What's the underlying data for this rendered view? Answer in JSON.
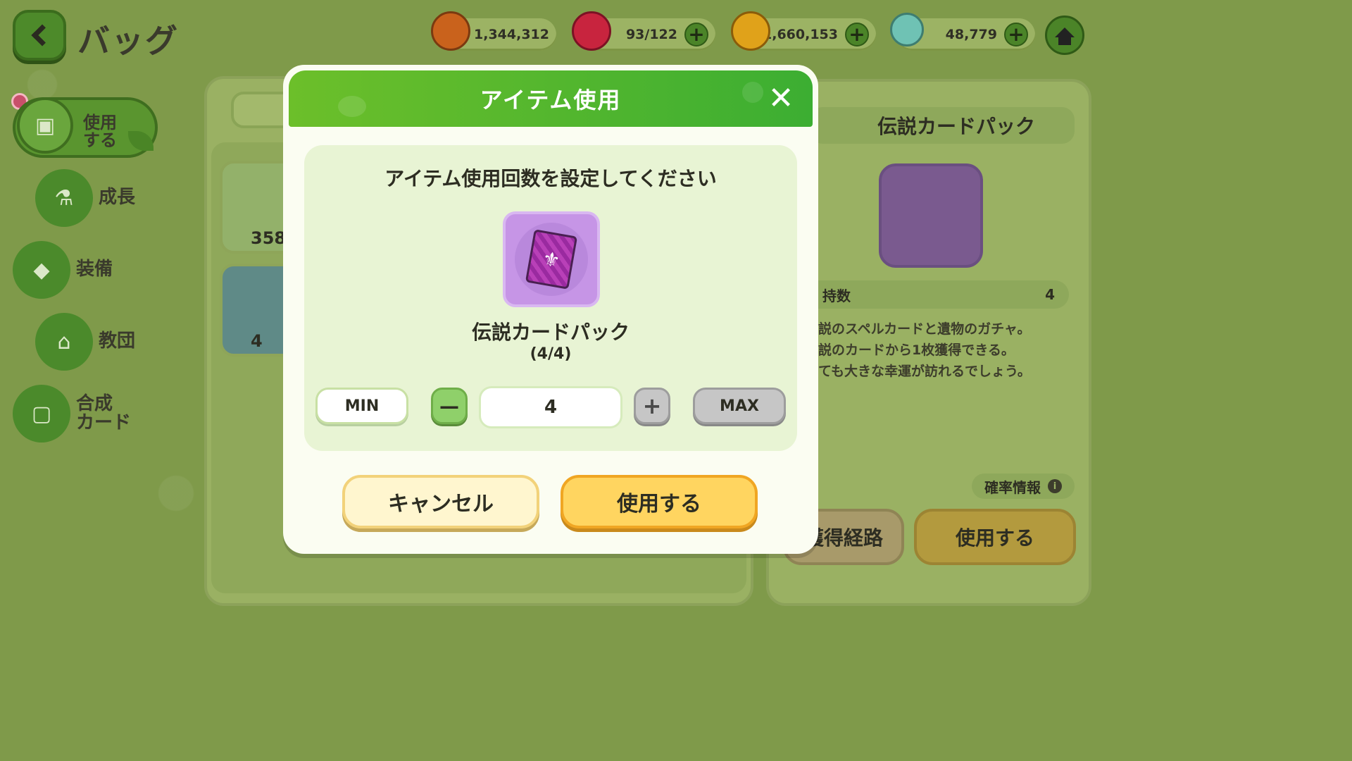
{
  "header": {
    "title": "バッグ",
    "back_icon": "chevron-left-icon",
    "home_icon": "home-icon"
  },
  "currencies": [
    {
      "name": "macaron",
      "icon": "macaron-icon",
      "value": "1,344,312",
      "color": "#c9621c",
      "has_plus": false
    },
    {
      "name": "stamina",
      "icon": "red-candy-icon",
      "value": "93/122",
      "color": "#c8243e",
      "has_plus": true
    },
    {
      "name": "gold",
      "icon": "gold-coin-icon",
      "value": "1,660,153",
      "color": "#e0a21a",
      "has_plus": true
    },
    {
      "name": "crystal",
      "icon": "crystal-leaf-icon",
      "value": "48,779",
      "color": "#6fc2b4",
      "has_plus": true
    }
  ],
  "sidebar": {
    "items": [
      {
        "label_line1": "使用",
        "label_line2": "する",
        "active": true
      },
      {
        "label": "成長"
      },
      {
        "label": "装備"
      },
      {
        "label": "教団"
      },
      {
        "label_line1": "合成",
        "label_line2": "カード"
      }
    ]
  },
  "inventory": {
    "slots": [
      {
        "count": "358"
      },
      {
        "count": "4"
      }
    ]
  },
  "detail_panel": {
    "title": "伝説カードパック",
    "stat_label": "持数",
    "stat_value": "4",
    "description": [
      "説のスペルカードと遺物のガチャ。",
      "説のカードから1枚獲得できる。",
      "ても大きな幸運が訪れるでしょう。"
    ],
    "prob_label": "確率情報",
    "route_label": "獲得経路",
    "use_label": "使用する"
  },
  "modal": {
    "title": "アイテム使用",
    "prompt": "アイテム使用回数を設定してください",
    "item_name": "伝説カードパック",
    "item_count": "(4/4)",
    "min_label": "MIN",
    "minus_label": "—",
    "quantity": "4",
    "plus_label": "+",
    "max_label": "MAX",
    "cancel_label": "キャンセル",
    "confirm_label": "使用する",
    "accent_color": "#3cae32",
    "confirm_color": "#ffd560"
  }
}
